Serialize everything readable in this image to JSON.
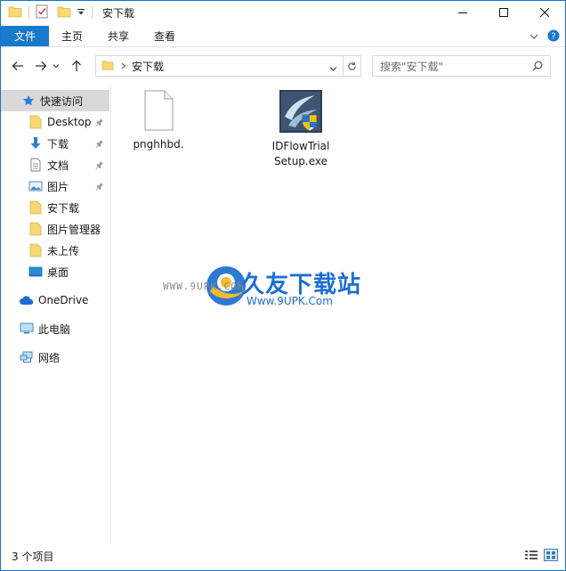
{
  "window": {
    "title": "安下载"
  },
  "ribbon": {
    "file": "文件",
    "home": "主页",
    "share": "共享",
    "view": "查看"
  },
  "address": {
    "path": "安下载",
    "search_placeholder": "搜索\"安下载\""
  },
  "sidebar": {
    "items": [
      {
        "label": "快速访问",
        "icon": "star-icon"
      },
      {
        "label": "Desktop",
        "icon": "folder-icon",
        "pinned": true
      },
      {
        "label": "下载",
        "icon": "download-arrow-icon",
        "pinned": true
      },
      {
        "label": "文档",
        "icon": "document-icon",
        "pinned": true
      },
      {
        "label": "图片",
        "icon": "picture-icon",
        "pinned": true
      },
      {
        "label": "安下载",
        "icon": "folder-icon"
      },
      {
        "label": "图片管理器",
        "icon": "folder-icon"
      },
      {
        "label": "未上传",
        "icon": "folder-icon"
      },
      {
        "label": "桌面",
        "icon": "desktop-icon"
      },
      {
        "label": "OneDrive",
        "icon": "cloud-icon"
      },
      {
        "label": "此电脑",
        "icon": "computer-icon"
      },
      {
        "label": "网络",
        "icon": "network-icon"
      }
    ]
  },
  "files": [
    {
      "name": "pnghhbd.",
      "icon": "blank-file-icon"
    },
    {
      "name": "IDFlowTrialSetup.exe",
      "icon": "installer-icon"
    }
  ],
  "status": {
    "count": "3 个项目"
  },
  "watermark": {
    "brand": "久友下载站",
    "url_sub": "Www.9UPK.Com",
    "url_side": "WWW.9UPK.COM"
  },
  "colors": {
    "accent": "#1979ca",
    "folder": "#f8d775",
    "selected": "#d9d9d9"
  }
}
